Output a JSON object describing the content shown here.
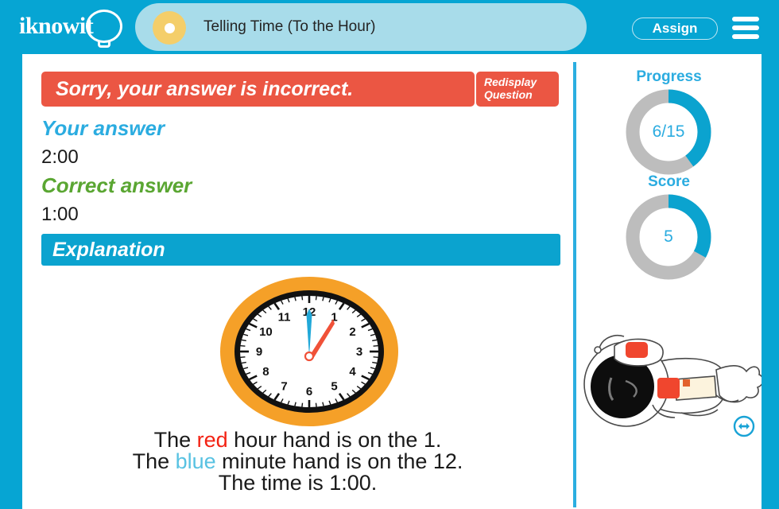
{
  "header": {
    "logo_text": "iknowit",
    "logo_icon": "lightbulb-icon",
    "lesson_title": "Telling Time (To the Hour)",
    "assign_label": "Assign",
    "menu_icon": "hamburger-menu-icon",
    "brand_color": "#06A5D3",
    "tab_color": "#A8DCEA",
    "dot_color": "#F4CE6A"
  },
  "main": {
    "result_banner": "Sorry, your answer is incorrect.",
    "result_color": "#EB5643",
    "redisplay_line1": "Redisplay",
    "redisplay_line2": "Question",
    "your_answer_label": "Your answer",
    "your_answer_value": "2:00",
    "your_answer_color": "#2BACE0",
    "correct_answer_label": "Correct answer",
    "correct_answer_value": "1:00",
    "correct_answer_color": "#5AA632",
    "explanation_label": "Explanation",
    "explanation_color": "#0BA3CF"
  },
  "clock": {
    "hours": [
      "1",
      "2",
      "3",
      "4",
      "5",
      "6",
      "7",
      "8",
      "9",
      "10",
      "11",
      "12"
    ],
    "hour_hand_points_to": "1",
    "minute_hand_points_to": "12",
    "hour_hand_color": "#F05138",
    "minute_hand_color": "#21A8D8",
    "rim_color": "#F5A028",
    "face_color": "#ffffff",
    "tick_color": "#000000"
  },
  "explanation_text": {
    "line1_a": "The ",
    "line1_red": "red",
    "line1_b": " hour hand is on the 1.",
    "line2_a": "The ",
    "line2_blue": "blue",
    "line2_b": " minute hand is on the 12.",
    "line3": "The time is 1:00.",
    "red_color": "#F32213",
    "blue_color": "#58C2E2"
  },
  "sidebar": {
    "progress_label": "Progress",
    "progress_value": "6/15",
    "progress_percent": 40,
    "score_label": "Score",
    "score_value": "5",
    "score_percent": 33,
    "ring_fill_color": "#0BA3CF",
    "ring_track_color": "#BDBDBD",
    "mascot": "astronaut-illustration",
    "nav_icon": "left-right-arrow-icon"
  }
}
